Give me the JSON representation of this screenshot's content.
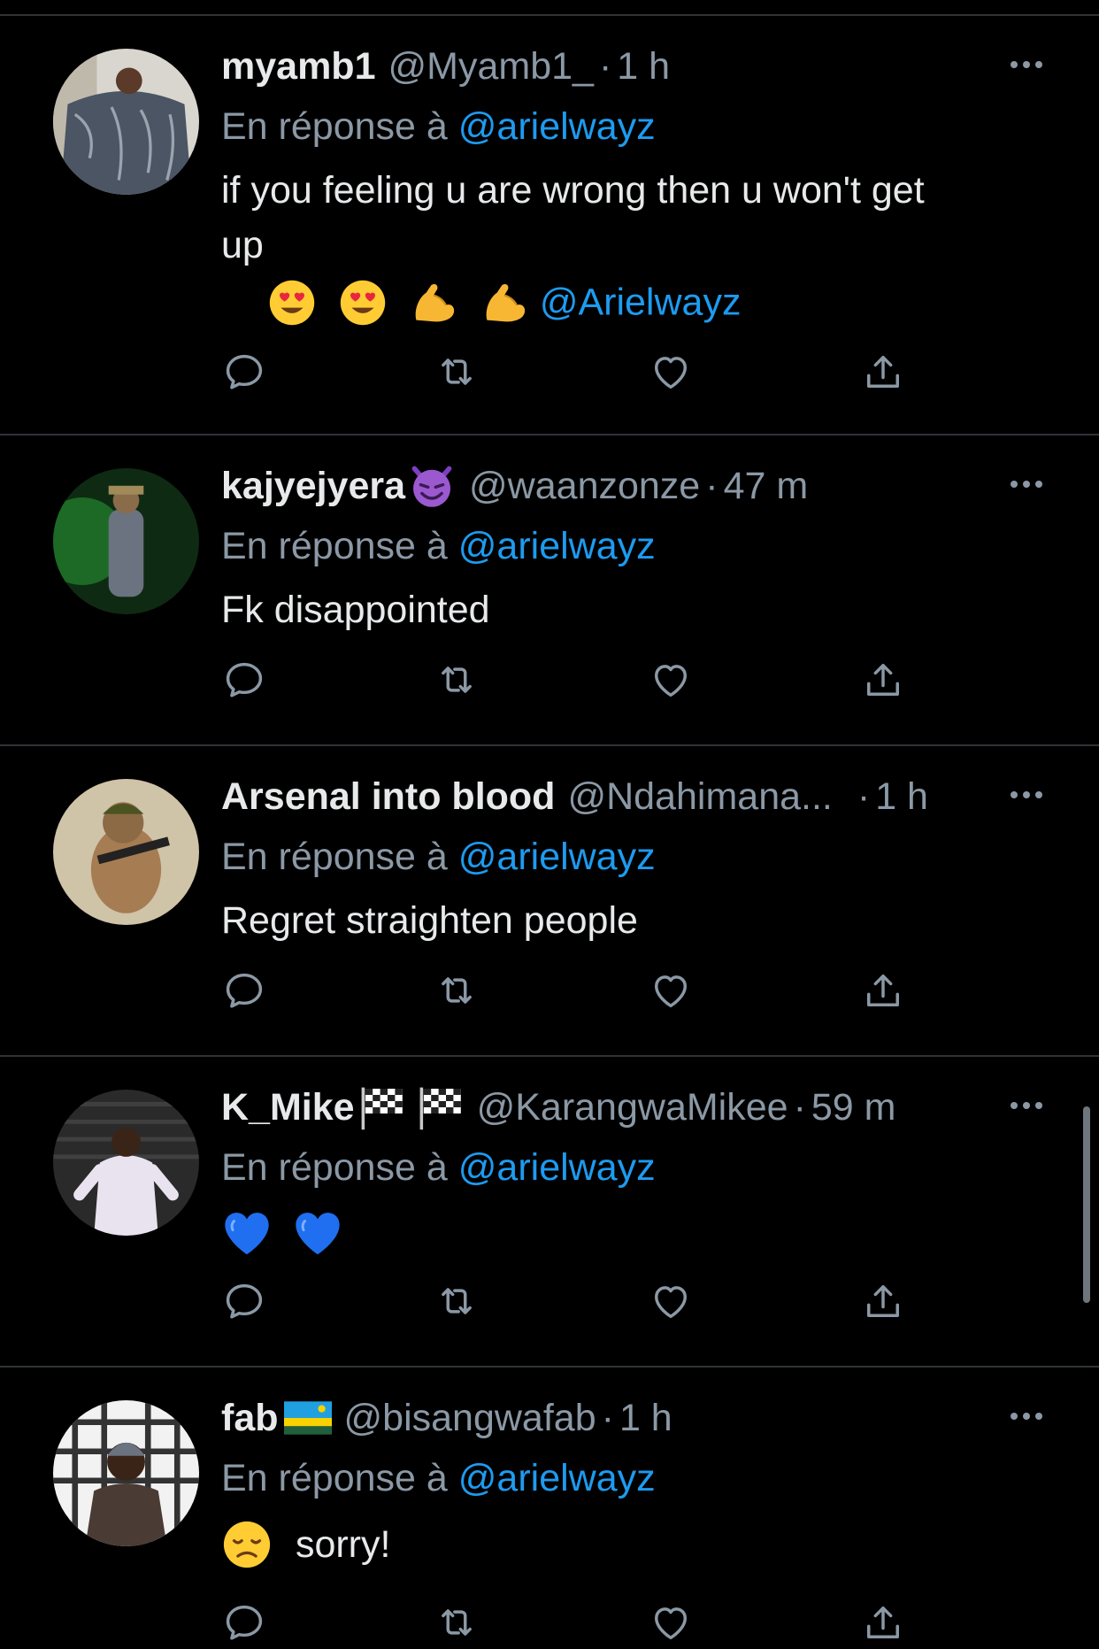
{
  "tweets": [
    {
      "name": "myamb1",
      "name_badges": [],
      "handle": "@Myamb1_",
      "time": "1 h",
      "reply_prefix": "En réponse à",
      "reply_to": "@arielwayz",
      "text_line1": "if you feeling u are wrong then u won't get",
      "text_line2": "up",
      "text_emojis": [
        "heart-eyes-emoji",
        "heart-eyes-emoji",
        "flexed-biceps-emoji",
        "flexed-biceps-emoji"
      ],
      "text_mention": "@Arielwayz"
    },
    {
      "name": "kajyejyera",
      "name_badges": [
        "smiling-devil-emoji"
      ],
      "handle": "@waanzonze",
      "time": "47 m",
      "reply_prefix": "En réponse à",
      "reply_to": "@arielwayz",
      "text": "Fk disappointed"
    },
    {
      "name": "Arsenal into blood",
      "name_badges": [],
      "handle": "@Ndahimana...",
      "time": "1 h",
      "reply_prefix": "En réponse à",
      "reply_to": "@arielwayz",
      "text": "Regret straighten people"
    },
    {
      "name": "K_Mike",
      "name_badges": [
        "checkered-flag-emoji",
        "checkered-flag-emoji"
      ],
      "handle": "@KarangwaMikee",
      "time": "59 m",
      "reply_prefix": "En réponse à",
      "reply_to": "@arielwayz",
      "text_emojis": [
        "blue-heart-emoji",
        "blue-heart-emoji"
      ]
    },
    {
      "name": "fab",
      "name_badges": [
        "rwanda-flag-emoji"
      ],
      "handle": "@bisangwafab",
      "time": "1 h",
      "reply_prefix": "En réponse à",
      "reply_to": "@arielwayz",
      "text_emojis": [
        "disappointed-face-emoji"
      ],
      "text": "sorry!"
    }
  ],
  "separator": "·",
  "colors": {
    "background": "#000000",
    "text": "#e7e9ea",
    "secondary": "#8b98a5",
    "accent": "#1d9bf0",
    "divider": "#2f3336"
  },
  "action_icons": [
    "reply-icon",
    "retweet-icon",
    "like-icon",
    "share-icon"
  ]
}
